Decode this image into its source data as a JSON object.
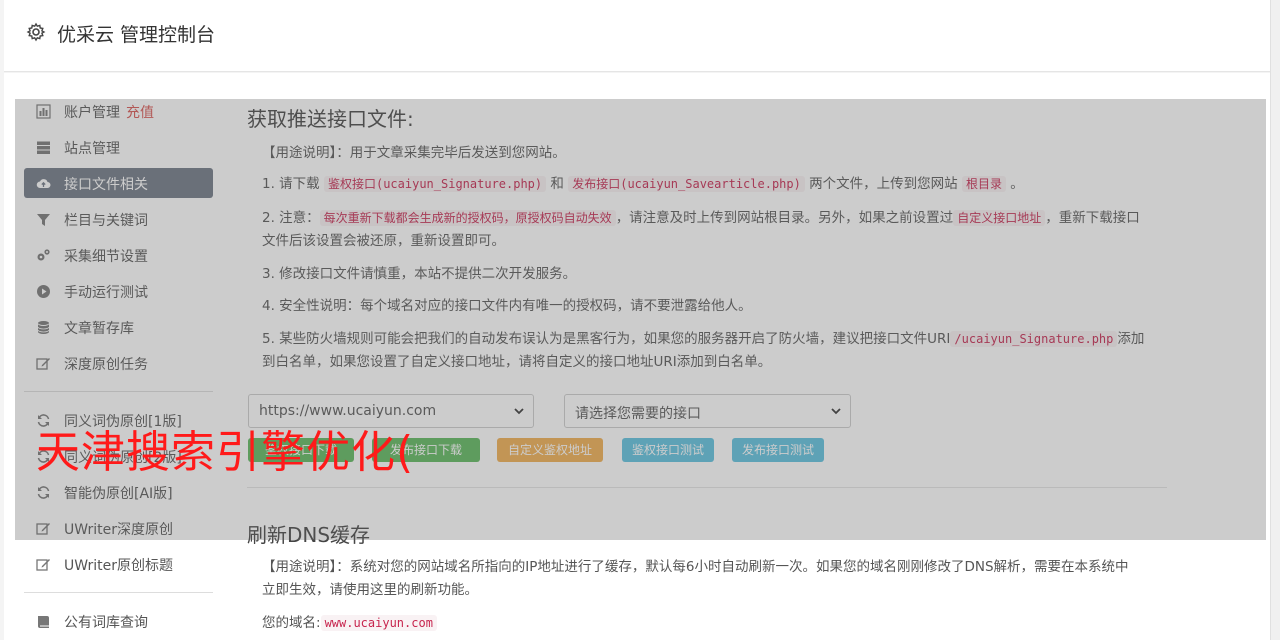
{
  "header": {
    "title": "优采云 管理控制台",
    "icon": "gear-icon"
  },
  "sidebar": {
    "items": [
      {
        "label": "账户管理",
        "badge": "充值",
        "icon": "bar-chart-icon"
      },
      {
        "label": "站点管理",
        "icon": "server-icon"
      },
      {
        "label": "接口文件相关",
        "icon": "cloud-upload-icon",
        "active": true
      },
      {
        "label": "栏目与关键词",
        "icon": "filter-icon"
      },
      {
        "label": "采集细节设置",
        "icon": "cogs-icon"
      },
      {
        "label": "手动运行测试",
        "icon": "play-icon"
      },
      {
        "label": "文章暂存库",
        "icon": "database-icon"
      },
      {
        "label": "深度原创任务",
        "icon": "edit-icon"
      },
      {
        "label": "同义词伪原创[1版]",
        "icon": "refresh-icon"
      },
      {
        "label": "同义词伪原创[2版]",
        "icon": "refresh-icon"
      },
      {
        "label": "智能伪原创[AI版]",
        "icon": "refresh-icon"
      },
      {
        "label": "UWriter深度原创",
        "icon": "edit-icon"
      },
      {
        "label": "UWriter原创标题",
        "icon": "edit-icon"
      },
      {
        "label": "公有词库查询",
        "icon": "book-icon"
      }
    ]
  },
  "section1": {
    "title": "获取推送接口文件:",
    "usage": "【用途说明】：用于文章采集完毕后发送到您网站。",
    "p1_a": "1. 请下载 ",
    "p1_code1": "鉴权接口(ucaiyun_Signature.php)",
    "p1_b": " 和 ",
    "p1_code2": "发布接口(ucaiyun_Savearticle.php)",
    "p1_c": " 两个文件，上传到您网站 ",
    "p1_code3": "根目录",
    "p1_d": " 。",
    "p2_a": "2. 注意：",
    "p2_code1": "每次重新下载都会生成新的授权码，原授权码自动失效",
    "p2_b": "，请注意及时上传到网站根目录。另外，如果之前设置过",
    "p2_code2": "自定义接口地址",
    "p2_c": "，重新下载接口文件后该设置会被还原，重新设置即可。",
    "p3": "3. 修改接口文件请慎重，本站不提供二次开发服务。",
    "p4": "4. 安全性说明：每个域名对应的接口文件内有唯一的授权码，请不要泄露给他人。",
    "p5_a": "5. 某些防火墙规则可能会把我们的自动发布误认为是黑客行为，如果您的服务器开启了防火墙，建议把接口文件URI",
    "p5_code": "/ucaiyun_Signature.php",
    "p5_b": "添加到白名单，如果您设置了自定义接口地址，请将自定义的接口地址URI添加到白名单。",
    "site_select": "https://www.ucaiyun.com",
    "api_select": "请选择您需要的接口",
    "btn_auth_download": "鉴权接口下载",
    "btn_publish_download": "发布接口下载",
    "btn_custom_auth": "自定义鉴权地址",
    "btn_auth_test": "鉴权接口测试",
    "btn_publish_test": "发布接口测试"
  },
  "section2": {
    "title": "刷新DNS缓存",
    "usage": "【用途说明】：系统对您的网站域名所指向的IP地址进行了缓存，默认每6小时自动刷新一次。如果您的域名刚刚修改了DNS解析，需要在本系统中立即生效，请使用这里的刷新功能。",
    "domain_label": "您的域名:",
    "domain_value": "www.ucaiyun.com"
  },
  "watermark": "天津搜索引擎优化(",
  "colors": {
    "active_nav": "#6e7684",
    "green": "#5cb85c",
    "blue": "#5bc0de",
    "orange": "#f0ad4e",
    "code": "#c7254e",
    "watermark": "#ff1a1a"
  }
}
